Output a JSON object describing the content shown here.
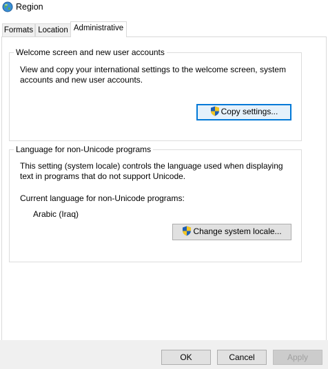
{
  "window": {
    "title": "Region",
    "icon": "globe-region-icon"
  },
  "tabs": [
    {
      "label": "Formats",
      "active": false
    },
    {
      "label": "Location",
      "active": false
    },
    {
      "label": "Administrative",
      "active": true
    }
  ],
  "welcome_group": {
    "legend": "Welcome screen and new user accounts",
    "description_line1": "View and copy your international settings to the welcome screen, system",
    "description_line2": "accounts and new user accounts.",
    "copy_button": {
      "label": "Copy settings...",
      "icon": "uac-shield-icon"
    }
  },
  "unicode_group": {
    "legend": "Language for non-Unicode programs",
    "description_line1": "This setting (system locale) controls the language used when displaying",
    "description_line2": "text in programs that do not support Unicode.",
    "current_label": "Current language for non-Unicode programs:",
    "current_value": "Arabic (Iraq)",
    "change_button": {
      "label": "Change system locale...",
      "icon": "uac-shield-icon"
    }
  },
  "footer": {
    "ok_label": "OK",
    "cancel_label": "Cancel",
    "apply_label": "Apply",
    "apply_enabled": false
  },
  "colors": {
    "focus_border": "#0078d7",
    "button_face": "#e1e1e1",
    "shield_blue": "#1e5fb4",
    "shield_yellow": "#f3c623"
  }
}
